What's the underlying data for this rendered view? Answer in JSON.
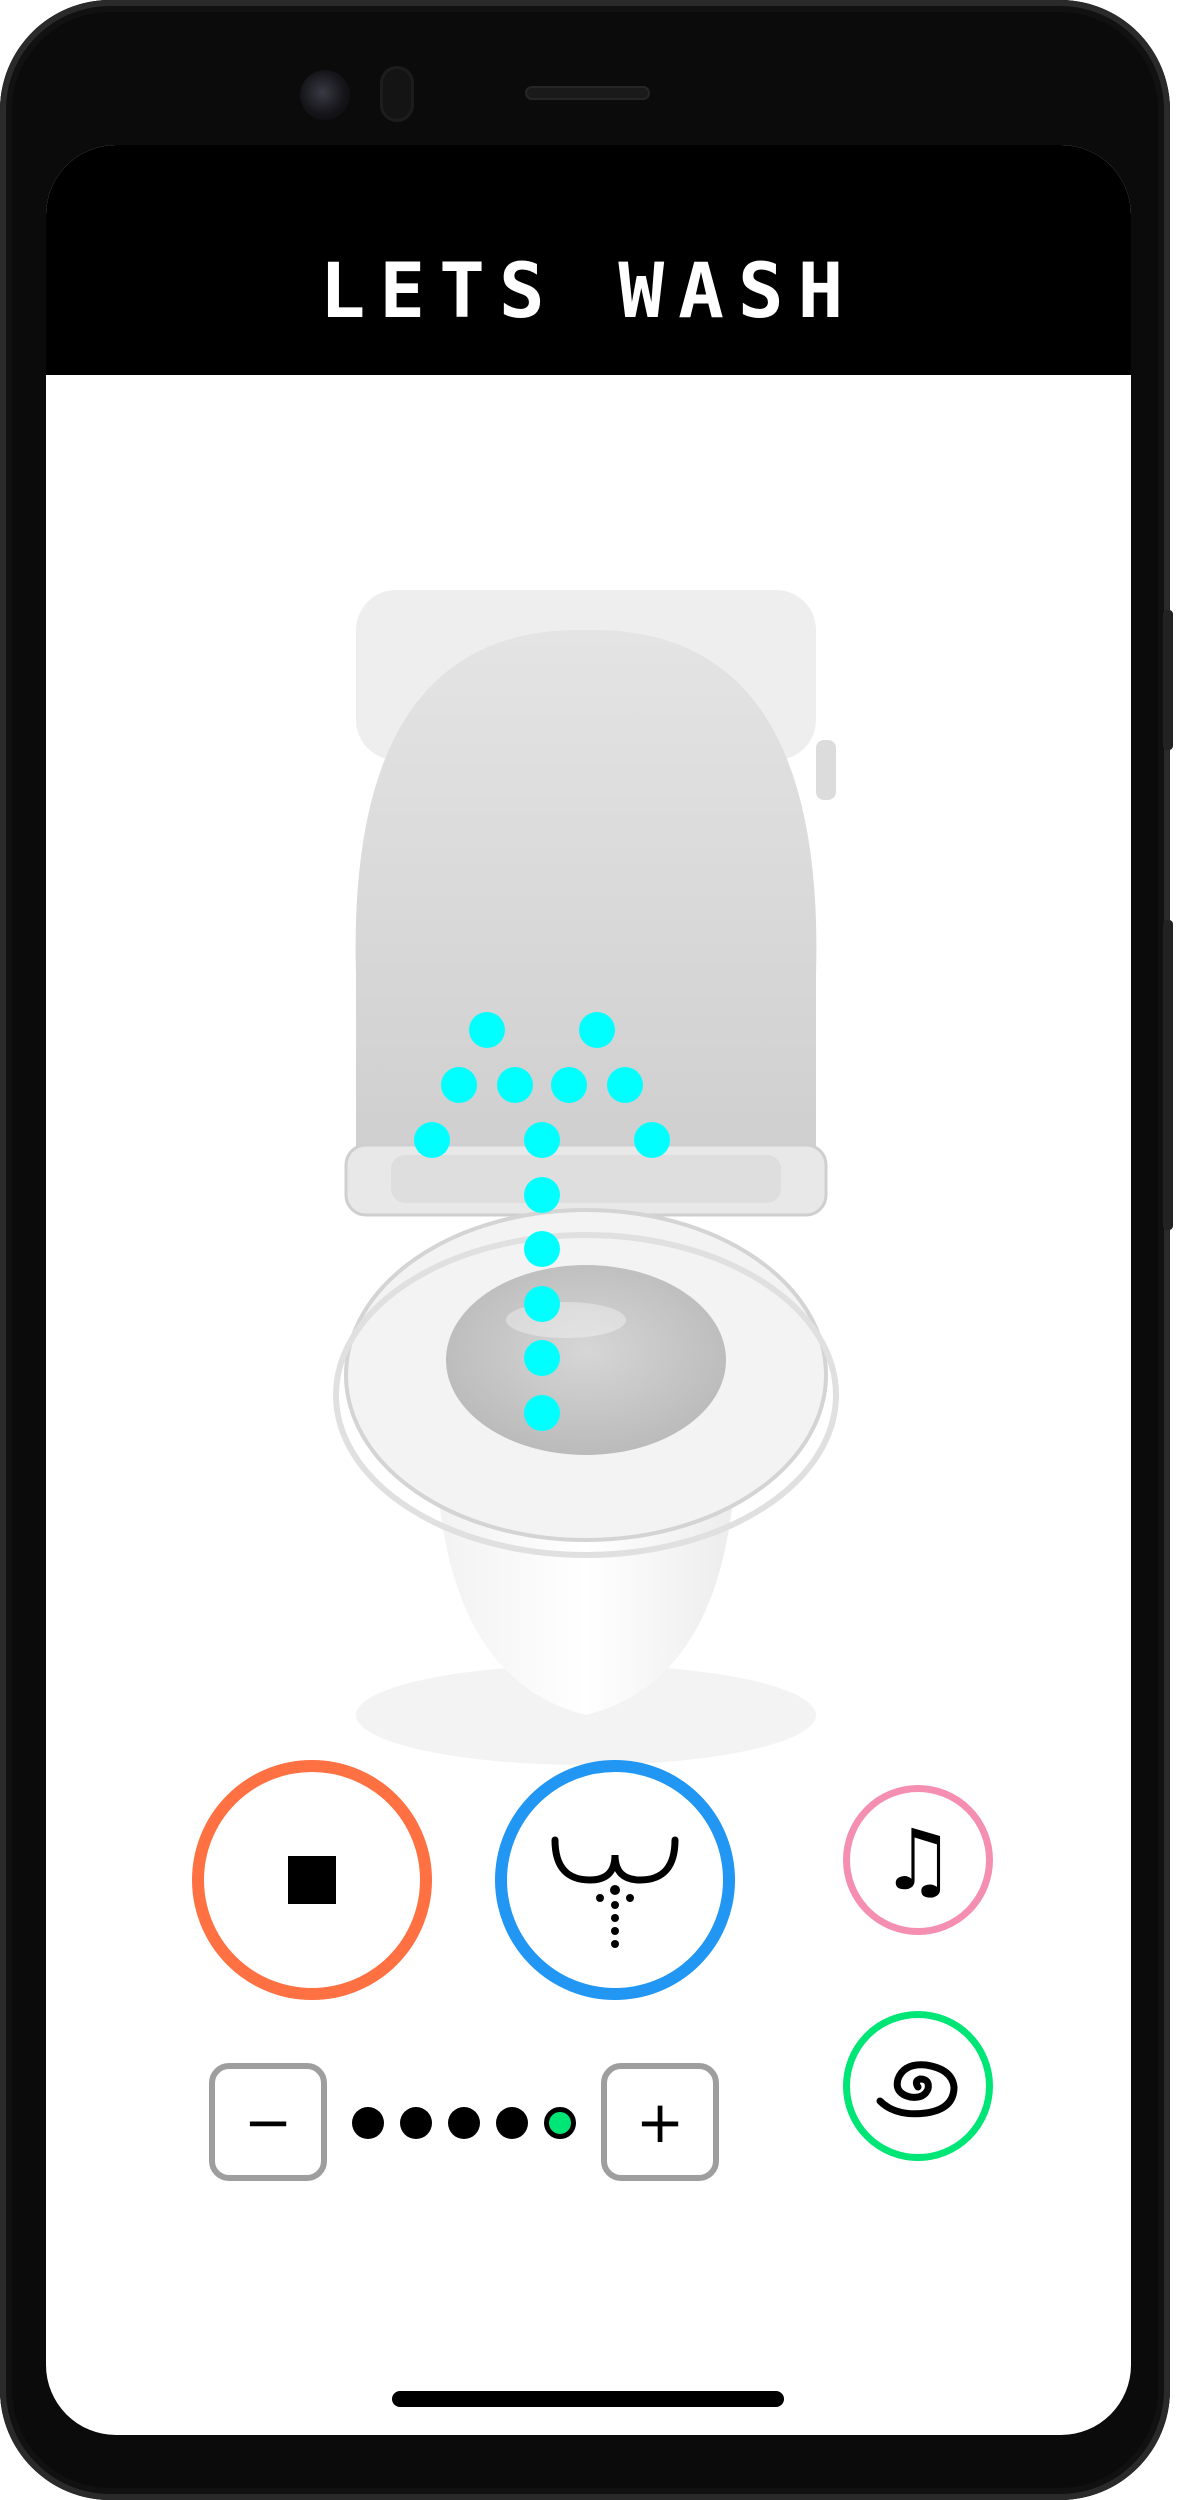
{
  "app": {
    "title": "LETS WASH"
  },
  "controls": {
    "stop": {
      "icon": "stop-square-icon",
      "color": "#ff7043"
    },
    "wash": {
      "icon": "bidet-spray-icon",
      "color": "#2196f3"
    },
    "music": {
      "icon": "music-note-icon",
      "glyph": "♫",
      "color": "#f48fb1"
    },
    "dry": {
      "icon": "swirl-air-icon",
      "color": "#00e676"
    }
  },
  "pressure": {
    "minus_label": "−",
    "plus_label": "+",
    "levels": 5,
    "current_level": 5
  },
  "colors": {
    "spray_dots": "#00ffff",
    "header_bg": "#000000",
    "level_active": "#00e676"
  }
}
